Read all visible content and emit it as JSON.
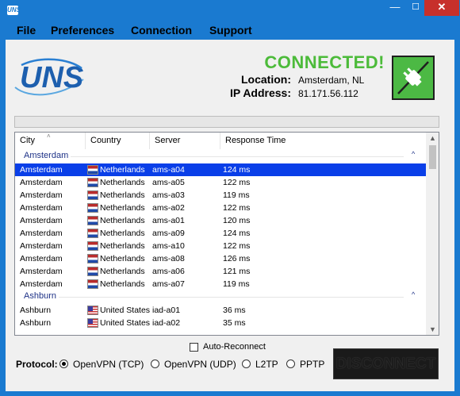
{
  "app": {
    "icon_text": "UNS",
    "window_controls": {
      "minimize": "—",
      "maximize": "☐",
      "close": "✕"
    }
  },
  "menu": [
    "File",
    "Preferences",
    "Connection",
    "Support"
  ],
  "status": {
    "text": "CONNECTED!",
    "location_label": "Location:",
    "location_value": "Amsterdam, NL",
    "ip_label": "IP Address:",
    "ip_value": "81.171.56.112"
  },
  "columns": [
    "City",
    "Country",
    "Server",
    "Response Time"
  ],
  "groups": [
    {
      "name": "Amsterdam",
      "rows": [
        {
          "city": "Amsterdam",
          "country": "Netherlands",
          "flag": "nl",
          "server": "ams-a04",
          "time": "124 ms",
          "selected": true
        },
        {
          "city": "Amsterdam",
          "country": "Netherlands",
          "flag": "nl",
          "server": "ams-a05",
          "time": "122 ms"
        },
        {
          "city": "Amsterdam",
          "country": "Netherlands",
          "flag": "nl",
          "server": "ams-a03",
          "time": "119 ms"
        },
        {
          "city": "Amsterdam",
          "country": "Netherlands",
          "flag": "nl",
          "server": "ams-a02",
          "time": "122 ms"
        },
        {
          "city": "Amsterdam",
          "country": "Netherlands",
          "flag": "nl",
          "server": "ams-a01",
          "time": "120 ms"
        },
        {
          "city": "Amsterdam",
          "country": "Netherlands",
          "flag": "nl",
          "server": "ams-a09",
          "time": "124 ms"
        },
        {
          "city": "Amsterdam",
          "country": "Netherlands",
          "flag": "nl",
          "server": "ams-a10",
          "time": "122 ms"
        },
        {
          "city": "Amsterdam",
          "country": "Netherlands",
          "flag": "nl",
          "server": "ams-a08",
          "time": "126 ms"
        },
        {
          "city": "Amsterdam",
          "country": "Netherlands",
          "flag": "nl",
          "server": "ams-a06",
          "time": "121 ms"
        },
        {
          "city": "Amsterdam",
          "country": "Netherlands",
          "flag": "nl",
          "server": "ams-a07",
          "time": "119 ms"
        }
      ]
    },
    {
      "name": "Ashburn",
      "rows": [
        {
          "city": "Ashburn",
          "country": "United States",
          "flag": "us",
          "server": "iad-a01",
          "time": "36 ms"
        },
        {
          "city": "Ashburn",
          "country": "United States",
          "flag": "us",
          "server": "iad-a02",
          "time": "35 ms"
        }
      ]
    }
  ],
  "auto_reconnect": {
    "label": "Auto-Reconnect",
    "checked": false
  },
  "protocol": {
    "label": "Protocol:",
    "options": [
      {
        "label": "OpenVPN (TCP)",
        "selected": true
      },
      {
        "label": "OpenVPN (UDP)",
        "selected": false
      },
      {
        "label": "L2TP",
        "selected": false
      },
      {
        "label": "PPTP",
        "selected": false
      }
    ]
  },
  "disconnect_label": "DISCONNECT",
  "colors": {
    "accent": "#1a7ad0",
    "connected": "#4cbb3a",
    "selection": "#0a3fe8",
    "close": "#c7302b"
  }
}
